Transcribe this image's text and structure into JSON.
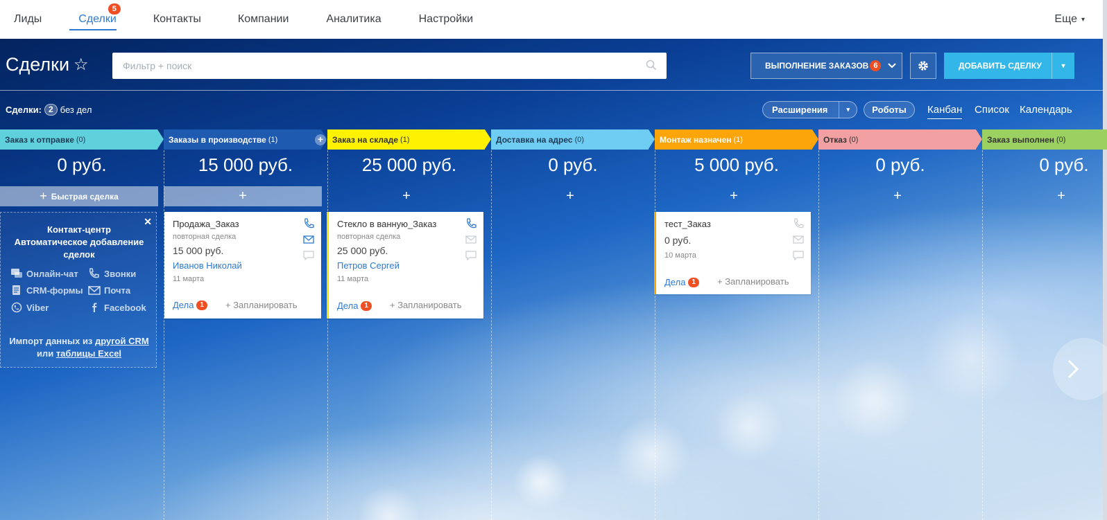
{
  "nav": {
    "items": [
      {
        "label": "Лиды"
      },
      {
        "label": "Сделки",
        "badge": "5",
        "active": true
      },
      {
        "label": "Контакты"
      },
      {
        "label": "Компании"
      },
      {
        "label": "Аналитика"
      },
      {
        "label": "Настройки"
      }
    ],
    "more_label": "Еще"
  },
  "header": {
    "title": "Сделки",
    "search_placeholder": "Фильтр + поиск",
    "funnel_label": "ВЫПОЛНЕНИЕ ЗАКАЗОВ",
    "funnel_badge": "6",
    "add_label": "ДОБАВИТЬ СДЕЛКУ"
  },
  "toolbar": {
    "deals_prefix": "Сделки:",
    "deals_count": "2",
    "deals_suffix": "без дел",
    "extensions_label": "Расширения",
    "robots_label": "Роботы",
    "views": [
      "Канбан",
      "Список",
      "Календарь"
    ]
  },
  "columns": [
    {
      "name": "Заказ к отправке",
      "count": "(0)",
      "sum": "0 руб.",
      "color": "#5fd1dc",
      "text_color": "#1f3a55"
    },
    {
      "name": "Заказы в производстве",
      "count": "(1)",
      "sum": "15 000 руб.",
      "color": "#1e5ab0",
      "text_color": "#ffffff"
    },
    {
      "name": "Заказ на складе",
      "count": "(1)",
      "sum": "25 000 руб.",
      "color": "#fff200",
      "text_color": "#333333"
    },
    {
      "name": "Доставка на адрес",
      "count": "(0)",
      "sum": "0 руб.",
      "color": "#6fcdf4",
      "text_color": "#1f3a55"
    },
    {
      "name": "Монтаж назначен",
      "count": "(1)",
      "sum": "5 000 руб.",
      "color": "#fba50a",
      "text_color": "#ffffff"
    },
    {
      "name": "Отказ",
      "count": "(0)",
      "sum": "0 руб.",
      "color": "#f3a0a3",
      "text_color": "#333333"
    },
    {
      "name": "Заказ выполнен",
      "count": "(0)",
      "sum": "0 руб.",
      "color": "#9bd160",
      "text_color": "#333333"
    }
  ],
  "quick_deal_label": "Быстрая сделка",
  "contact_center": {
    "title": "Контакт-центр Автоматическое добавление сделок",
    "items": [
      "Онлайн-чат",
      "Звонки",
      "CRM-формы",
      "Почта",
      "Viber",
      "Facebook"
    ],
    "import_text_1": "Импорт данных из",
    "import_link_1": "другой CRM",
    "import_text_2": "или",
    "import_link_2": "таблицы Excel"
  },
  "cards": [
    {
      "title": "Продажа_Заказ",
      "subtitle": "повторная сделка",
      "price": "15 000 руб.",
      "contact": "Иванов Николай",
      "date": "11 марта",
      "tasks_label": "Дела",
      "tasks_count": "1",
      "plan_label": "+ Запланировать"
    },
    {
      "title": "Стекло в ванную_Заказ",
      "subtitle": "повторная сделка",
      "price": "25 000 руб.",
      "contact": "Петров Сергей",
      "date": "11 марта",
      "tasks_label": "Дела",
      "tasks_count": "1",
      "plan_label": "+ Запланировать"
    },
    {
      "title": "тест_Заказ",
      "price": "0 руб.",
      "date": "10 марта",
      "tasks_label": "Дела",
      "tasks_count": "1",
      "plan_label": "+ Запланировать"
    }
  ],
  "icons": {
    "star": "star-icon",
    "search": "search-icon",
    "gear": "gear-icon",
    "phone": "phone-icon",
    "mail": "mail-icon",
    "chat": "chat-icon",
    "next": "chevron-right-icon"
  }
}
